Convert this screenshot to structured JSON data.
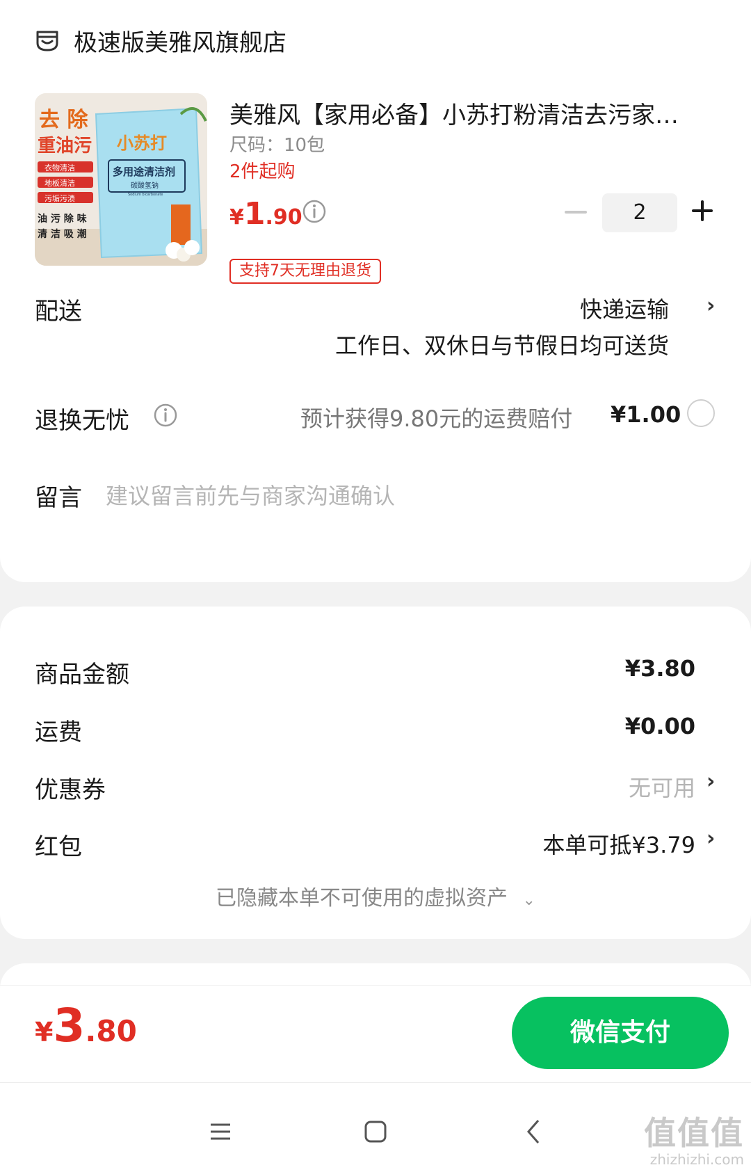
{
  "store": {
    "name": "极速版美雅风旗舰店"
  },
  "product": {
    "title": "美雅风【家用必备】小苏打粉清洁去污家…",
    "spec": "尺码：10包",
    "min_purchase": "2件起购",
    "price_symbol": "¥",
    "price_int": "1",
    "price_dec": ".90",
    "quantity": "2",
    "return_badge": "支持7天无理由退货",
    "image_text": {
      "left_title": "去 除",
      "left_sub": "重油污",
      "tags": [
        "衣物清洁",
        "地板清洁",
        "污垢污渍"
      ],
      "bottom_left": "油 污  除 味",
      "bottom_left2": "清 洁  吸 潮",
      "pack_title": "小苏打",
      "pack_main": "多用途清洁剂",
      "pack_sub": "碳酸氢钠",
      "pack_en": "Sodium bicarbonate"
    }
  },
  "delivery": {
    "label": "配送",
    "value": "快递运输",
    "sub": "工作日、双休日与节假日均可送货"
  },
  "return_worry": {
    "label": "退换无忧",
    "description": "预计获得9.80元的运费赔付",
    "price": "¥1.00"
  },
  "message": {
    "label": "留言",
    "placeholder": "建议留言前先与商家沟通确认"
  },
  "pricing": {
    "goods_label": "商品金额",
    "goods_value": "¥3.80",
    "shipping_label": "运费",
    "shipping_value": "¥0.00",
    "coupon_label": "优惠券",
    "coupon_value": "无可用",
    "redpacket_label": "红包",
    "redpacket_value": "本单可抵¥3.79",
    "hidden_assets": "已隐藏本单不可使用的虚拟资产"
  },
  "checkout": {
    "total_symbol": "¥",
    "total_int": "3",
    "total_dec": ".80",
    "pay_button": "微信支付"
  },
  "watermark": {
    "big": "值值值",
    "small": "zhizhizhi.com"
  },
  "colors": {
    "accent_red": "#e02e24",
    "wechat_green": "#07c160"
  }
}
